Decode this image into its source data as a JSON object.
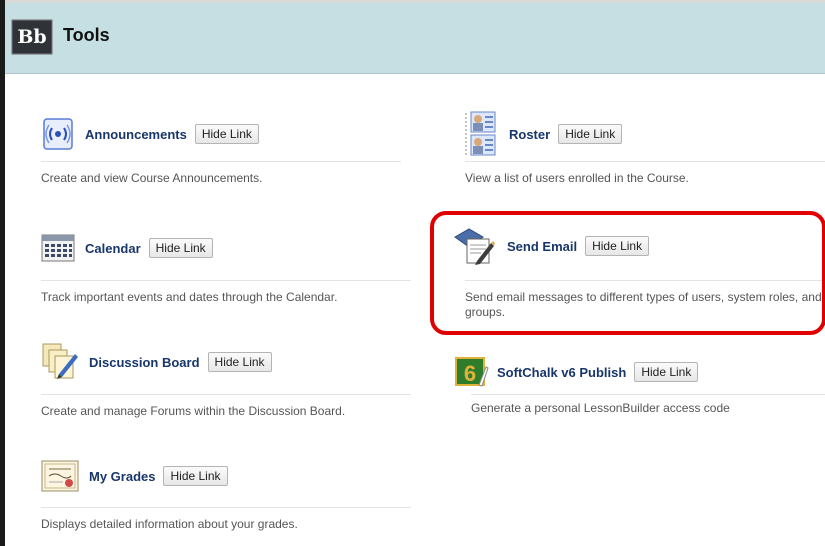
{
  "header": {
    "logo_text": "Bb",
    "title": "Tools"
  },
  "hide_label": "Hide Link",
  "tools": {
    "announcements": {
      "name": "Announcements",
      "description": "Create and view Course Announcements.",
      "icon": "broadcast-icon"
    },
    "roster": {
      "name": "Roster",
      "description": "View a list of users enrolled in the Course.",
      "icon": "roster-icon"
    },
    "calendar": {
      "name": "Calendar",
      "description": "Track important events and dates through the Calendar.",
      "icon": "calendar-icon"
    },
    "send_email": {
      "name": "Send Email",
      "description": "Send email messages to different types of users, system roles, and groups.",
      "icon": "email-icon"
    },
    "discussion_board": {
      "name": "Discussion Board",
      "description": "Create and manage Forums within the Discussion Board.",
      "icon": "discussion-icon"
    },
    "softchalk": {
      "name": "SoftChalk v6 Publish",
      "description": "Generate a personal LessonBuilder access code",
      "icon": "softchalk-icon",
      "icon_text": "6"
    },
    "my_grades": {
      "name": "My Grades",
      "description": "Displays detailed information about your grades.",
      "icon": "certificate-icon"
    }
  },
  "colors": {
    "header_bg": "#c5dfe2",
    "link": "#18366b",
    "highlight": "#e00000"
  }
}
